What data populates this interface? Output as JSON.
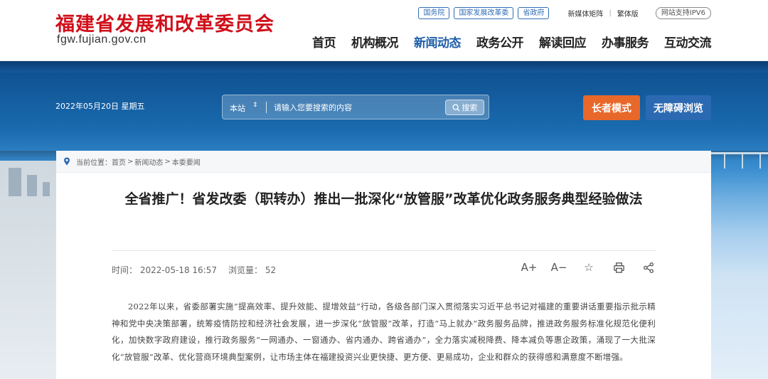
{
  "site": {
    "name_cn": "福建省发展和改革委员会",
    "domain": "fgw.fujian.gov.cn"
  },
  "toplinks": [
    "国务院",
    "国家发展改革委",
    "省政府"
  ],
  "lang": {
    "media": "新媒体矩阵",
    "separator": "|",
    "traditional": "繁体版"
  },
  "ipv6": "网站支持IPV6",
  "nav": [
    "首页",
    "机构概况",
    "新闻动态",
    "政务公开",
    "解读回应",
    "办事服务",
    "互动交流"
  ],
  "banner": {
    "date": "2022年05月20日 星期五",
    "search": {
      "scope": "本站",
      "scope_arrow": "⇕",
      "placeholder": "请输入您要搜索的内容",
      "button": "搜索"
    },
    "elder_mode": "长者模式",
    "accessible": "无障碍浏览"
  },
  "breadcrumb": {
    "prefix": "当前位置：",
    "items": [
      "首页",
      "新闻动态",
      "本委要闻"
    ],
    "sep": ">"
  },
  "article": {
    "title": "全省推广！省发改委（职转办）推出一批深化“放管服”改革优化政务服务典型经验做法",
    "time_label": "时间：",
    "time": "2022-05-18 16:57",
    "views_label": "浏览量：",
    "views": "52",
    "tools": {
      "font_up": "A+",
      "font_down": "A−",
      "favorite": "☆",
      "print": "print",
      "share": "share"
    },
    "body": "2022年以来，省委部署实施“提高效率、提升效能、提增效益”行动，各级各部门深入贯彻落实习近平总书记对福建的重要讲话重要指示批示精神和党中央决策部署，统筹疫情防控和经济社会发展，进一步深化“放管服”改革，打造“马上就办”政务服务品牌，推进政务服务标准化规范化便利化，加快数字政府建设，推行政务服务“一网通办、一窗通办、省内通办、跨省通办”，全力落实减税降费、降本减负等惠企政策，涌现了一大批深化“放管服”改革、优化营商环境典型案例，让市场主体在福建投资兴业更快捷、更方便、更易成功，企业和群众的获得感和满意度不断增强。"
  },
  "colors": {
    "brand_red": "#d0101b",
    "nav_active": "#1e5ea8",
    "elder_btn": "#e8682a",
    "access_btn": "#2b6ab3"
  }
}
